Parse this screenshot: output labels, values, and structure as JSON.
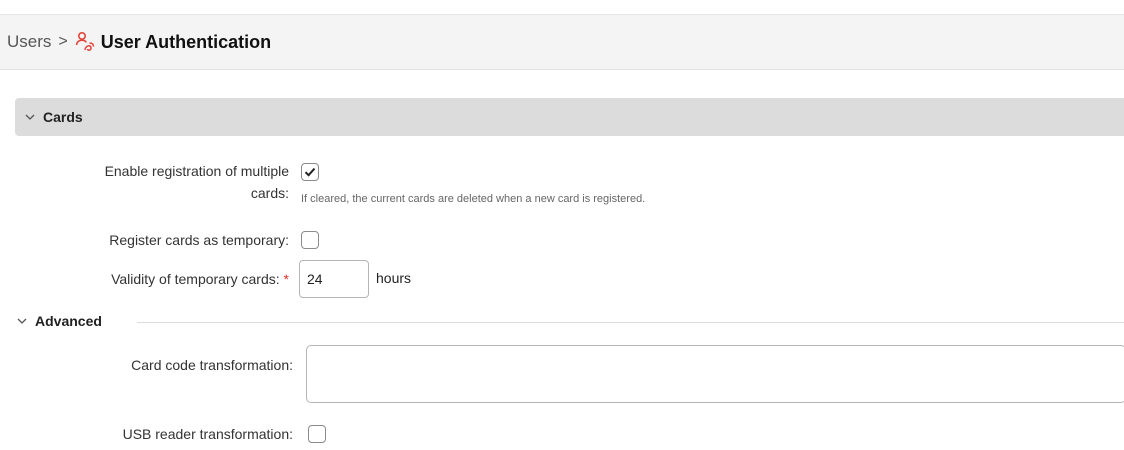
{
  "breadcrumb": {
    "parent": "Users",
    "separator": ">",
    "current": "User Authentication",
    "icon": "user-auth-icon",
    "icon_color": "#e0463b"
  },
  "cards_section": {
    "title": "Cards",
    "enable_multiple": {
      "label_line1": "Enable registration of multiple",
      "label_line2": "cards:",
      "checked": true,
      "hint": "If cleared, the current cards are deleted when a new card is registered."
    },
    "register_temporary": {
      "label": "Register cards as temporary:",
      "checked": false
    },
    "validity": {
      "label": "Validity of temporary cards:",
      "required_mark": "*",
      "value": "24",
      "unit": "hours"
    }
  },
  "advanced_section": {
    "title": "Advanced",
    "card_code_transformation": {
      "label": "Card code transformation:",
      "value": ""
    },
    "usb_reader_transformation": {
      "label": "USB reader transformation:",
      "checked": false
    }
  }
}
